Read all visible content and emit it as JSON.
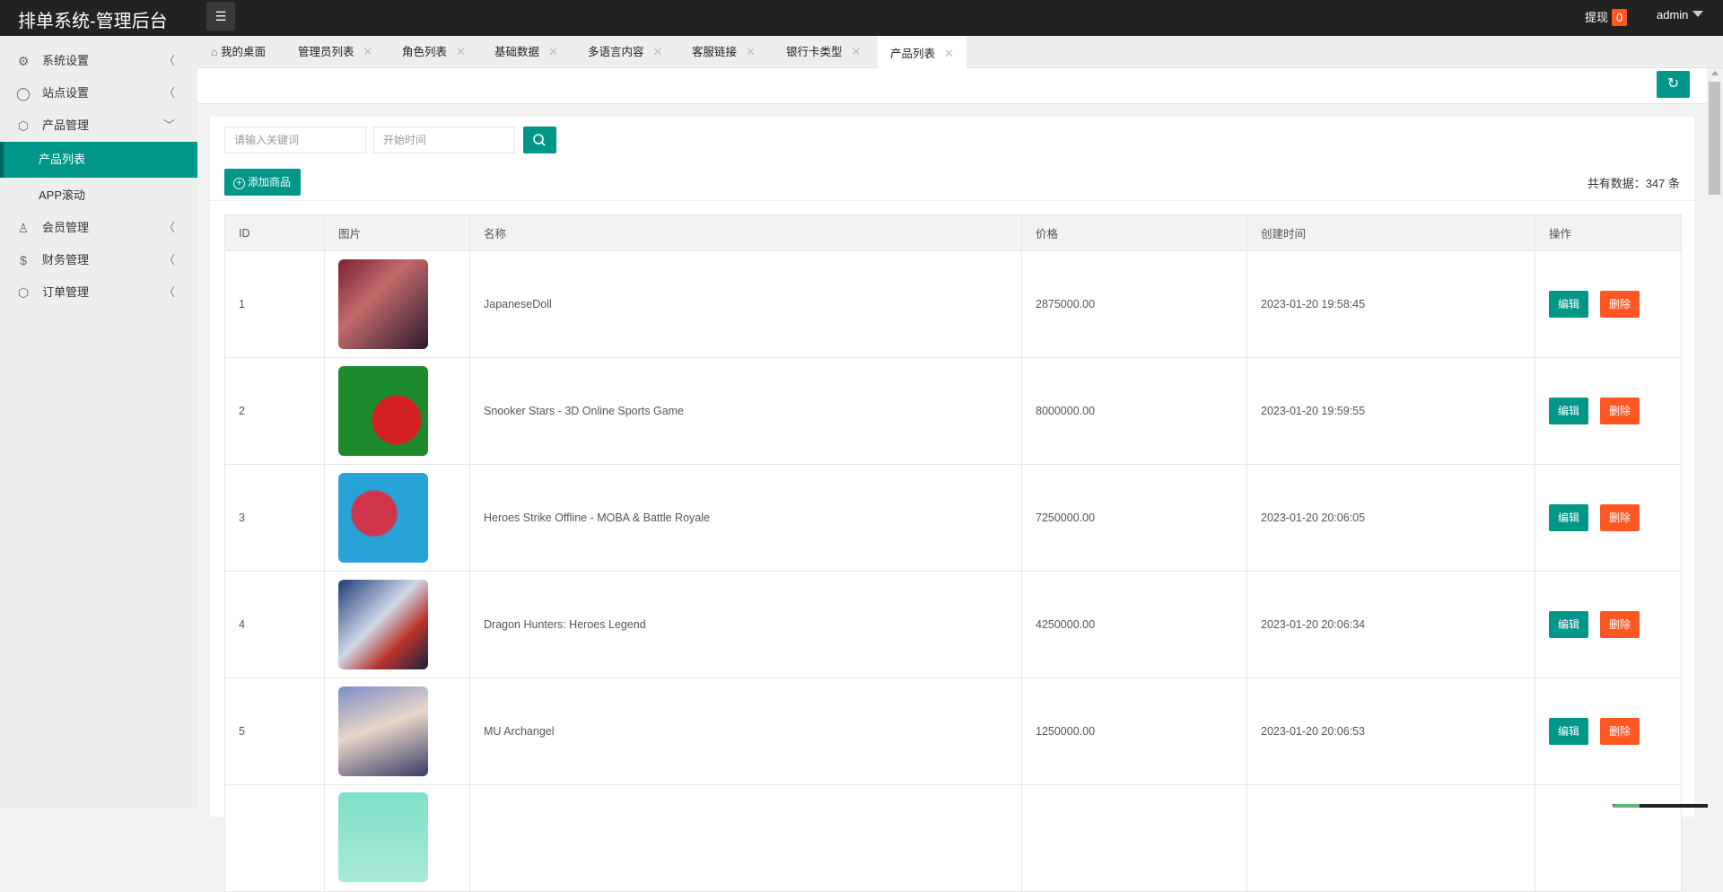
{
  "header": {
    "title": "排单系统-管理后台",
    "withdraw_label": "提现",
    "withdraw_count": "0",
    "user": "admin"
  },
  "sidebar": {
    "items": [
      {
        "label": "系统设置",
        "icon": "gear-icon"
      },
      {
        "label": "站点设置",
        "icon": "site-icon"
      },
      {
        "label": "产品管理",
        "icon": "box-icon",
        "children": [
          {
            "label": "产品列表",
            "active": true
          },
          {
            "label": "APP滚动"
          }
        ]
      },
      {
        "label": "会员管理",
        "icon": "user-icon"
      },
      {
        "label": "财务管理",
        "icon": "dollar-icon"
      },
      {
        "label": "订单管理",
        "icon": "box-icon"
      }
    ]
  },
  "tabs": [
    {
      "label": "我的桌面"
    },
    {
      "label": "管理员列表"
    },
    {
      "label": "角色列表"
    },
    {
      "label": "基础数据"
    },
    {
      "label": "多语言内容"
    },
    {
      "label": "客服链接"
    },
    {
      "label": "银行卡类型"
    },
    {
      "label": "产品列表",
      "active": true
    }
  ],
  "tab_close": "✕",
  "search": {
    "keyword_placeholder": "请输入关键词",
    "start_time_placeholder": "开始时间"
  },
  "toolbar": {
    "add_label": "添加商品",
    "total_text": "共有数据：347 条"
  },
  "table": {
    "columns": [
      "ID",
      "图片",
      "名称",
      "价格",
      "创建时间",
      "操作"
    ],
    "edit_label": "编辑",
    "delete_label": "删除",
    "rows": [
      {
        "id": "1",
        "name": "JapaneseDoll",
        "price": "2875000.00",
        "created": "2023-01-20 19:58:45",
        "img": "linear-gradient(135deg,#7a2233,#c26a6a 40%,#2b1a2e)"
      },
      {
        "id": "2",
        "name": "Snooker Stars - 3D Online Sports Game",
        "price": "8000000.00",
        "created": "2023-01-20 19:59:55",
        "img": "radial-gradient(circle at 65% 60%,#d32020 0 30%,#1e8a2e 32%)"
      },
      {
        "id": "3",
        "name": "Heroes Strike Offline - MOBA & Battle Royale",
        "price": "7250000.00",
        "created": "2023-01-20 20:06:05",
        "img": "radial-gradient(circle at 40% 45%,#d0344a 0 30%,#27a3d8 33%)"
      },
      {
        "id": "4",
        "name": "Dragon Hunters: Heroes Legend",
        "price": "4250000.00",
        "created": "2023-01-20 20:06:34",
        "img": "linear-gradient(135deg,#1d3c78,#cfd8e8 45%,#b8332a 70%,#1a2340)"
      },
      {
        "id": "5",
        "name": "MU Archangel",
        "price": "1250000.00",
        "created": "2023-01-20 20:06:53",
        "img": "linear-gradient(160deg,#7d8cc8,#e8d6c8 45%,#3a3c66)"
      },
      {
        "id": "",
        "name": "",
        "price": "",
        "created": "",
        "img": "linear-gradient(#7fe0c8,#a8ead8)"
      }
    ]
  }
}
